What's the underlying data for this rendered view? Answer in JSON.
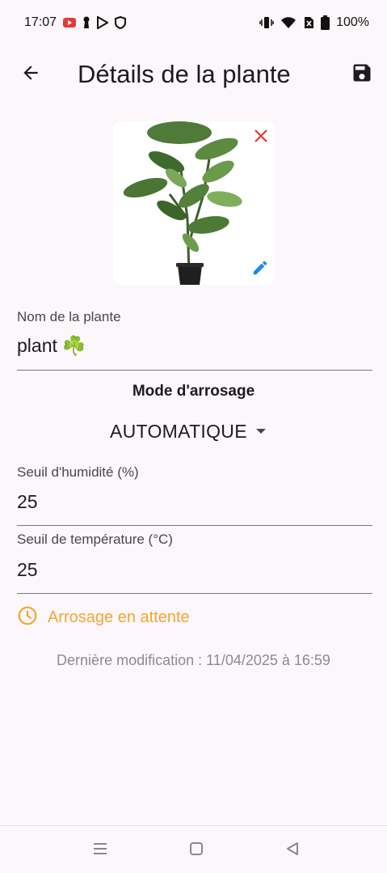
{
  "status_bar": {
    "time": "17:07",
    "battery": "100%",
    "icons": [
      "youtube-icon",
      "keyhole-icon",
      "play-store-icon",
      "shield-icon",
      "vibrate-icon",
      "wifi-icon",
      "no-sim-icon",
      "battery-icon"
    ]
  },
  "app_bar": {
    "title": "Détails de la plante",
    "back_icon": "arrow-back-icon",
    "save_icon": "save-icon"
  },
  "plant_image": {
    "description_icon": "plant-photo",
    "remove_icon": "close-icon",
    "edit_icon": "edit-pencil-icon",
    "colors": {
      "remove": "#e53935",
      "edit": "#1e88e5"
    }
  },
  "fields": {
    "name": {
      "label": "Nom de la plante",
      "value": "plant ☘️"
    },
    "humidity": {
      "label": "Seuil d'humidité (%)",
      "value": "25"
    },
    "temperature": {
      "label": "Seuil de température (°C)",
      "value": "25"
    }
  },
  "watering_mode": {
    "title": "Mode d'arrosage",
    "selected": "AUTOMATIQUE"
  },
  "watering_status": {
    "icon": "clock-icon",
    "label": "Arrosage en attente",
    "color": "#f2a530"
  },
  "last_modified": "Dernière modification : 11/04/2025 à 16:59",
  "nav_bar": {
    "icons": [
      "menu-icon",
      "home-icon",
      "back-icon"
    ]
  }
}
